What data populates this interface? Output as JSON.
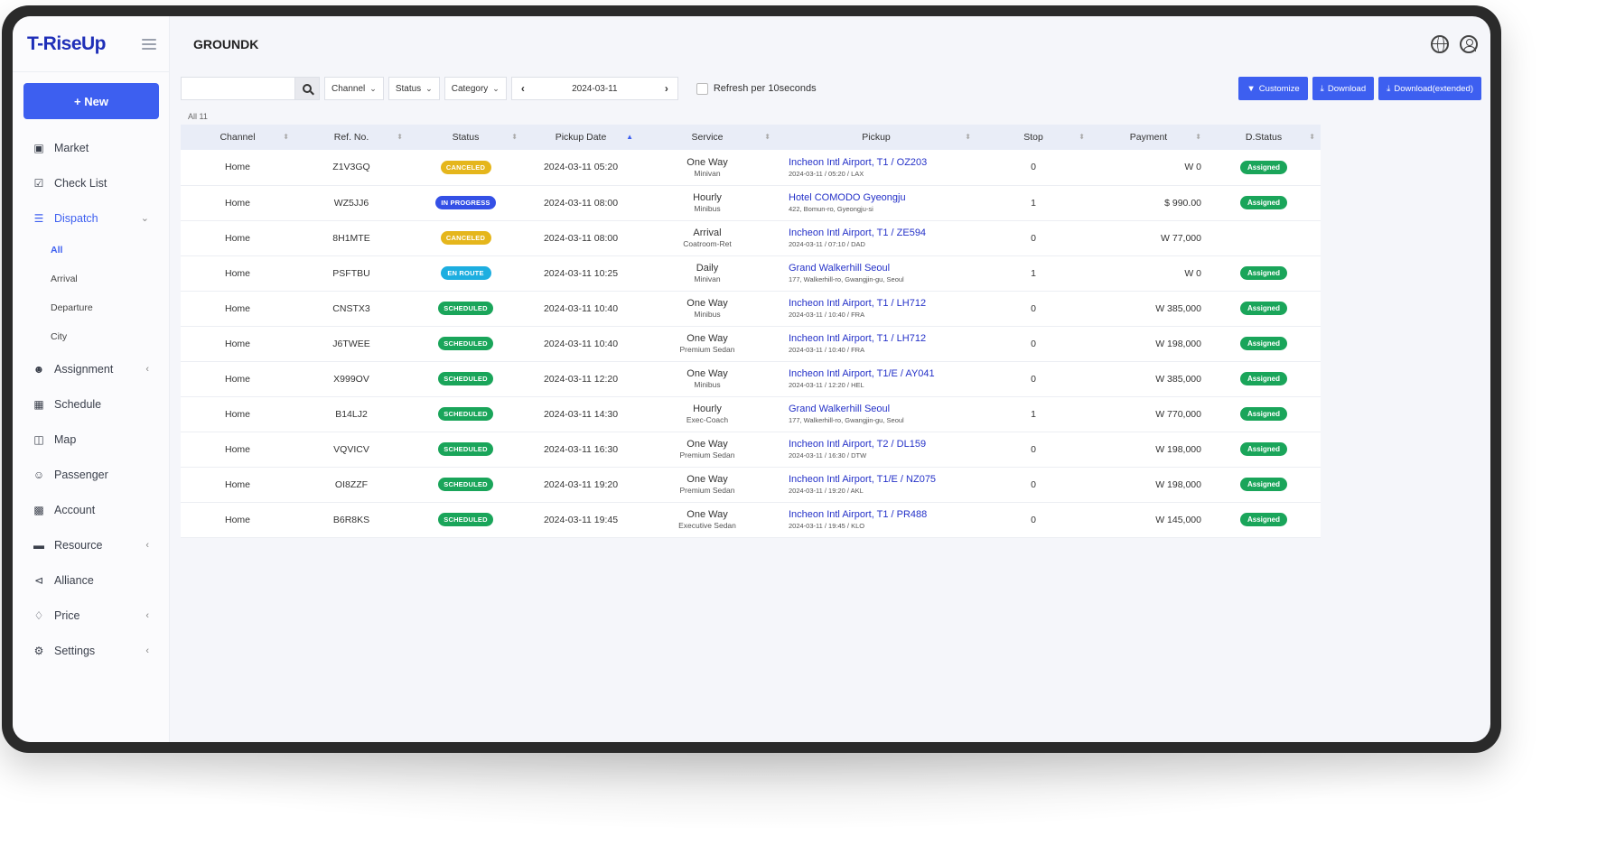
{
  "app": {
    "logo": "T-RiseUp",
    "page_title": "GROUNDK"
  },
  "sidebar": {
    "new_button": "+ New",
    "items": [
      {
        "label": "Market",
        "icon": "briefcase-icon"
      },
      {
        "label": "Check List",
        "icon": "checklist-icon"
      },
      {
        "label": "Dispatch",
        "icon": "list-icon",
        "active": true
      },
      {
        "label": "Assignment",
        "icon": "user-add-icon"
      },
      {
        "label": "Schedule",
        "icon": "calendar-icon"
      },
      {
        "label": "Map",
        "icon": "map-icon"
      },
      {
        "label": "Passenger",
        "icon": "users-icon"
      },
      {
        "label": "Account",
        "icon": "building-icon"
      },
      {
        "label": "Resource",
        "icon": "folder-icon"
      },
      {
        "label": "Alliance",
        "icon": "share-icon"
      },
      {
        "label": "Price",
        "icon": "tag-icon"
      },
      {
        "label": "Settings",
        "icon": "gear-icon"
      }
    ],
    "dispatch_sub": [
      "All",
      "Arrival",
      "Departure",
      "City"
    ]
  },
  "toolbar": {
    "search_placeholder": "",
    "channel": "Channel",
    "status": "Status",
    "category": "Category",
    "date": "2024-03-11",
    "refresh_label": "Refresh per 10seconds",
    "customize": "Customize",
    "download": "Download",
    "download_extended": "Download(extended)"
  },
  "table": {
    "count_label": "All 11",
    "columns": [
      "Channel",
      "Ref. No.",
      "Status",
      "Pickup Date",
      "Service",
      "Pickup",
      "Stop",
      "Payment",
      "D.Status"
    ],
    "rows": [
      {
        "channel": "Home",
        "ref": "Z1V3GQ",
        "status": "CANCELED",
        "status_key": "canceled",
        "date": "2024-03-11 05:20",
        "service": "One Way",
        "vehicle": "Minivan",
        "pickup": "Incheon Intl Airport, T1 / OZ203",
        "pickup_sub": "2024-03-11 / 05:20 / LAX",
        "stop": "0",
        "payment": "W 0",
        "dstatus": "Assigned"
      },
      {
        "channel": "Home",
        "ref": "WZ5JJ6",
        "status": "IN PROGRESS",
        "status_key": "inprogress",
        "date": "2024-03-11 08:00",
        "service": "Hourly",
        "vehicle": "Minibus",
        "pickup": "Hotel COMODO Gyeongju",
        "pickup_sub": "422, Bomun-ro, Gyeongju-si",
        "stop": "1",
        "payment": "$ 990.00",
        "dstatus": "Assigned"
      },
      {
        "channel": "Home",
        "ref": "8H1MTE",
        "status": "CANCELED",
        "status_key": "canceled",
        "date": "2024-03-11 08:00",
        "service": "Arrival",
        "vehicle": "Coatroom-Ret",
        "pickup": "Incheon Intl Airport, T1 / ZE594",
        "pickup_sub": "2024-03-11 / 07:10 / DAD",
        "stop": "0",
        "payment": "W 77,000",
        "dstatus": ""
      },
      {
        "channel": "Home",
        "ref": "PSFTBU",
        "status": "EN ROUTE",
        "status_key": "enroute",
        "date": "2024-03-11 10:25",
        "service": "Daily",
        "vehicle": "Minivan",
        "pickup": "Grand Walkerhill Seoul",
        "pickup_sub": "177, Walkerhill-ro, Gwangjin-gu, Seoul",
        "stop": "1",
        "payment": "W 0",
        "dstatus": "Assigned"
      },
      {
        "channel": "Home",
        "ref": "CNSTX3",
        "status": "SCHEDULED",
        "status_key": "scheduled",
        "date": "2024-03-11 10:40",
        "service": "One Way",
        "vehicle": "Minibus",
        "pickup": "Incheon Intl Airport, T1 / LH712",
        "pickup_sub": "2024-03-11 / 10:40 / FRA",
        "stop": "0",
        "payment": "W 385,000",
        "dstatus": "Assigned"
      },
      {
        "channel": "Home",
        "ref": "J6TWEE",
        "status": "SCHEDULED",
        "status_key": "scheduled",
        "date": "2024-03-11 10:40",
        "service": "One Way",
        "vehicle": "Premium Sedan",
        "pickup": "Incheon Intl Airport, T1 / LH712",
        "pickup_sub": "2024-03-11 / 10:40 / FRA",
        "stop": "0",
        "payment": "W 198,000",
        "dstatus": "Assigned"
      },
      {
        "channel": "Home",
        "ref": "X999OV",
        "status": "SCHEDULED",
        "status_key": "scheduled",
        "date": "2024-03-11 12:20",
        "service": "One Way",
        "vehicle": "Minibus",
        "pickup": "Incheon Intl Airport, T1/E / AY041",
        "pickup_sub": "2024-03-11 / 12:20 / HEL",
        "stop": "0",
        "payment": "W 385,000",
        "dstatus": "Assigned"
      },
      {
        "channel": "Home",
        "ref": "B14LJ2",
        "status": "SCHEDULED",
        "status_key": "scheduled",
        "date": "2024-03-11 14:30",
        "service": "Hourly",
        "vehicle": "Exec-Coach",
        "pickup": "Grand Walkerhill Seoul",
        "pickup_sub": "177, Walkerhill-ro, Gwangjin-gu, Seoul",
        "stop": "1",
        "payment": "W 770,000",
        "dstatus": "Assigned"
      },
      {
        "channel": "Home",
        "ref": "VQVICV",
        "status": "SCHEDULED",
        "status_key": "scheduled",
        "date": "2024-03-11 16:30",
        "service": "One Way",
        "vehicle": "Premium Sedan",
        "pickup": "Incheon Intl Airport, T2 / DL159",
        "pickup_sub": "2024-03-11 / 16:30 / DTW",
        "stop": "0",
        "payment": "W 198,000",
        "dstatus": "Assigned"
      },
      {
        "channel": "Home",
        "ref": "OI8ZZF",
        "status": "SCHEDULED",
        "status_key": "scheduled",
        "date": "2024-03-11 19:20",
        "service": "One Way",
        "vehicle": "Premium Sedan",
        "pickup": "Incheon Intl Airport, T1/E / NZ075",
        "pickup_sub": "2024-03-11 / 19:20 / AKL",
        "stop": "0",
        "payment": "W 198,000",
        "dstatus": "Assigned"
      },
      {
        "channel": "Home",
        "ref": "B6R8KS",
        "status": "SCHEDULED",
        "status_key": "scheduled",
        "date": "2024-03-11 19:45",
        "service": "One Way",
        "vehicle": "Executive Sedan",
        "pickup": "Incheon Intl Airport, T1 / PR488",
        "pickup_sub": "2024-03-11 / 19:45 / KLO",
        "stop": "0",
        "payment": "W 145,000",
        "dstatus": "Assigned"
      }
    ]
  },
  "colors": {
    "accent": "#3d5ff0",
    "canceled": "#e5b61c",
    "inprogress": "#3450e6",
    "enroute": "#1daee0",
    "scheduled": "#1aa55a",
    "link": "#2431c8"
  }
}
